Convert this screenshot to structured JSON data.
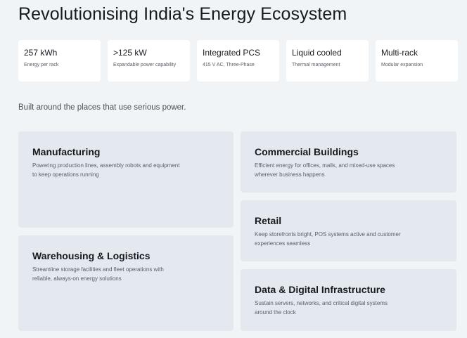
{
  "header": {
    "title": "Revolutionising India's Energy Ecosystem"
  },
  "stats": [
    {
      "value": "257 kWh",
      "label": "Energy per rack"
    },
    {
      "value": ">125 kW",
      "label": "Expandable power capability"
    },
    {
      "value": "Integrated PCS",
      "label": "415 V AC, Three-Phase"
    },
    {
      "value": "Liquid cooled",
      "label": "Thermal management"
    },
    {
      "value": "Multi-rack",
      "label": "Modular expansion"
    }
  ],
  "tagline": "Built around the places that use serious power.",
  "sectors": {
    "manufacturing": {
      "title": "Manufacturing",
      "description": "Powering production lines, assembly robots and equipment to keep operations running"
    },
    "warehousing": {
      "title": "Warehousing & Logistics",
      "description": "Streamline storage facilities and fleet operations with reliable, always-on energy solutions"
    },
    "commercial": {
      "title": "Commercial Buildings",
      "description": "Efficient energy for offices, malls, and mixed-use spaces wherever business happens"
    },
    "retail": {
      "title": "Retail",
      "description": "Keep storefronts bright, POS systems active and customer experiences seamless"
    },
    "datacenter": {
      "title": "Data & Digital Infrastructure",
      "description": "Sustain servers, networks, and critical digital systems around the clock"
    }
  },
  "colors": {
    "background": "#f1f4f7",
    "card_background": "#e3e9ef",
    "stat_background": "#ffffff"
  }
}
